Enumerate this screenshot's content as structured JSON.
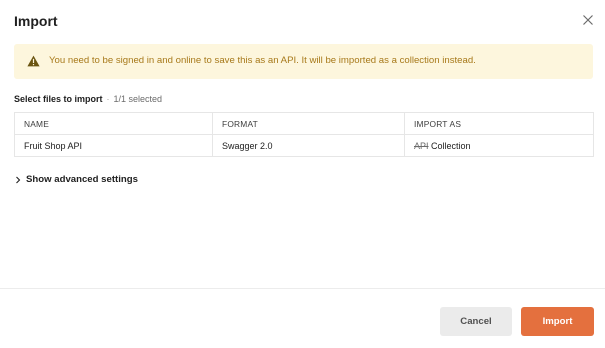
{
  "dialog": {
    "title": "Import",
    "close_icon": "close-icon"
  },
  "warning": {
    "icon": "warning-icon",
    "message": "You need to be signed in and online to save this as an API. It will be imported as a collection instead.",
    "color": "#a7791a",
    "background": "#fdf6dd"
  },
  "selection": {
    "label": "Select files to import",
    "separator": "·",
    "count": "1/1 selected"
  },
  "table": {
    "headers": [
      "NAME",
      "FORMAT",
      "IMPORT AS"
    ],
    "rows": [
      {
        "name": "Fruit Shop API",
        "format": "Swagger 2.0",
        "import_as_struck": "API",
        "import_as": "Collection"
      }
    ]
  },
  "advanced": {
    "label": "Show advanced settings",
    "icon": "chevron-right-icon"
  },
  "footer": {
    "cancel_label": "Cancel",
    "import_label": "Import",
    "accent": "#e4703e"
  }
}
